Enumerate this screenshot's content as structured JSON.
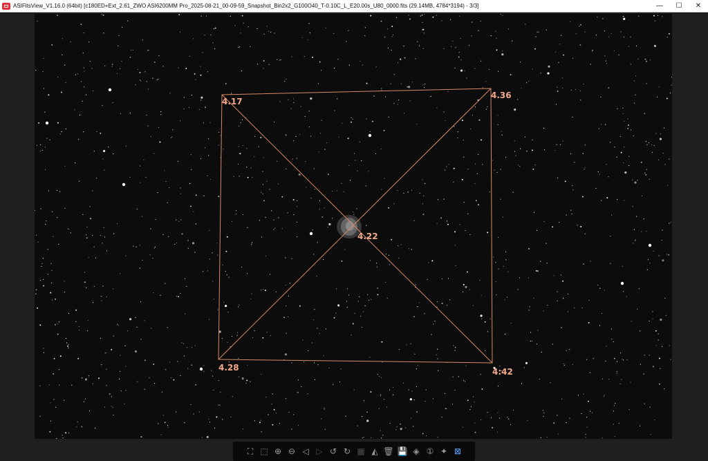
{
  "window": {
    "title": "ASIFitsView_V1.16.0 (64bit) [c180ED+Ext_2.61_ZWO ASI6200MM Pro_2025-08-21_00-09-59_Snapshot_Bin2x2_G100O40_T-0.10C_L_E20.00s_U80_0000.fits (29.14MB, 4784*3194) - 3/3]",
    "controls": {
      "minimize": "—",
      "maximize": "☐",
      "close": "✕"
    }
  },
  "overlay": {
    "color": "#d88a66",
    "labels": {
      "top_left": "4.17",
      "top_right": "4.36",
      "center": "4.22",
      "bottom_left": "4.28",
      "bottom_right": "4:42"
    }
  },
  "toolbar": {
    "buttons": [
      {
        "name": "fit-screen",
        "glyph": "⛶",
        "enabled": true
      },
      {
        "name": "actual-size",
        "glyph": "⬚",
        "enabled": true
      },
      {
        "name": "zoom-in",
        "glyph": "⊕",
        "enabled": true
      },
      {
        "name": "zoom-out",
        "glyph": "⊖",
        "enabled": true
      },
      {
        "name": "previous",
        "glyph": "◁",
        "enabled": true
      },
      {
        "name": "next",
        "glyph": "▷",
        "enabled": false
      },
      {
        "name": "rotate-left",
        "glyph": "↺",
        "enabled": true
      },
      {
        "name": "rotate-right",
        "glyph": "↻",
        "enabled": true
      },
      {
        "name": "stretch",
        "glyph": "▦",
        "enabled": false
      },
      {
        "name": "histogram",
        "glyph": "◭",
        "enabled": true
      },
      {
        "name": "delete",
        "glyph": "🗑",
        "enabled": true
      },
      {
        "name": "save",
        "glyph": "💾",
        "enabled": true
      },
      {
        "name": "star-detect",
        "glyph": "◈",
        "enabled": true
      },
      {
        "name": "one-to-one",
        "glyph": "①",
        "enabled": true
      },
      {
        "name": "annotate",
        "glyph": "✦",
        "enabled": true
      },
      {
        "name": "tilt-analysis",
        "glyph": "⊠",
        "enabled": true,
        "active": true
      }
    ]
  }
}
